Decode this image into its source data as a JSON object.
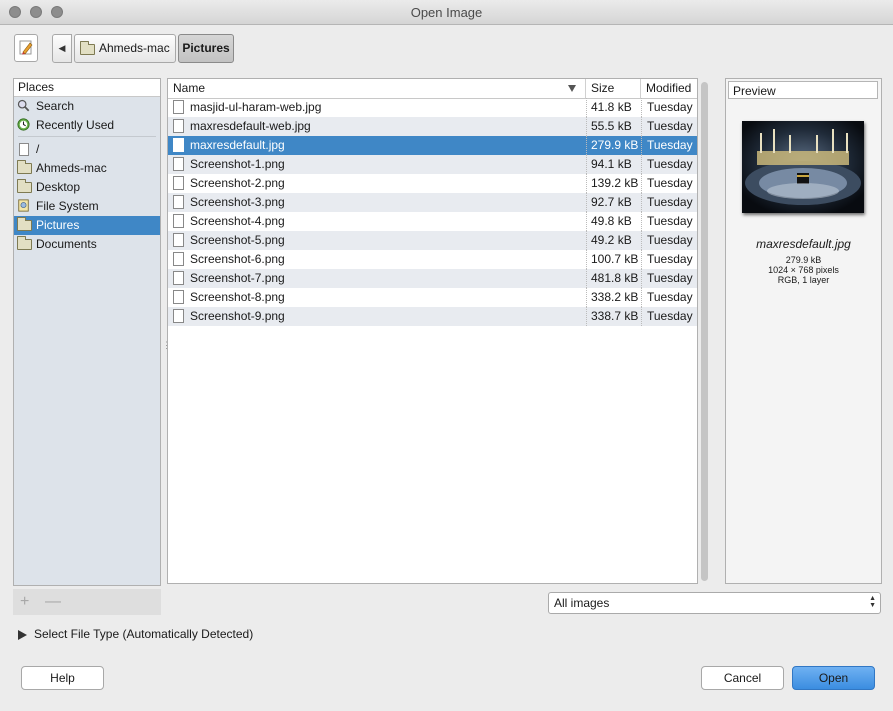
{
  "window": {
    "title": "Open Image"
  },
  "toolbar": {
    "breadcrumbs": [
      "Ahmeds-mac",
      "Pictures"
    ]
  },
  "places": {
    "header": "Places",
    "items": [
      {
        "label": "Search",
        "icon": "search-icon"
      },
      {
        "label": "Recently Used",
        "icon": "recent-icon"
      },
      {
        "label": "/",
        "icon": "document-icon"
      },
      {
        "label": "Ahmeds-mac",
        "icon": "folder-icon"
      },
      {
        "label": "Desktop",
        "icon": "folder-icon"
      },
      {
        "label": "File System",
        "icon": "drive-icon"
      },
      {
        "label": "Pictures",
        "icon": "folder-icon",
        "selected": true
      },
      {
        "label": "Documents",
        "icon": "folder-icon"
      }
    ]
  },
  "files": {
    "columns": {
      "name": "Name",
      "size": "Size",
      "modified": "Modified"
    },
    "rows": [
      {
        "name": "masjid-ul-haram-web.jpg",
        "size": "41.8 kB",
        "modified": "Tuesday"
      },
      {
        "name": "maxresdefault-web.jpg",
        "size": "55.5 kB",
        "modified": "Tuesday"
      },
      {
        "name": "maxresdefault.jpg",
        "size": "279.9 kB",
        "modified": "Tuesday",
        "selected": true
      },
      {
        "name": "Screenshot-1.png",
        "size": "94.1 kB",
        "modified": "Tuesday"
      },
      {
        "name": "Screenshot-2.png",
        "size": "139.2 kB",
        "modified": "Tuesday"
      },
      {
        "name": "Screenshot-3.png",
        "size": "92.7 kB",
        "modified": "Tuesday"
      },
      {
        "name": "Screenshot-4.png",
        "size": "49.8 kB",
        "modified": "Tuesday"
      },
      {
        "name": "Screenshot-5.png",
        "size": "49.2 kB",
        "modified": "Tuesday"
      },
      {
        "name": "Screenshot-6.png",
        "size": "100.7 kB",
        "modified": "Tuesday"
      },
      {
        "name": "Screenshot-7.png",
        "size": "481.8 kB",
        "modified": "Tuesday"
      },
      {
        "name": "Screenshot-8.png",
        "size": "338.2 kB",
        "modified": "Tuesday"
      },
      {
        "name": "Screenshot-9.png",
        "size": "338.7 kB",
        "modified": "Tuesday"
      }
    ]
  },
  "preview": {
    "header": "Preview",
    "filename": "maxresdefault.jpg",
    "size": "279.9 kB",
    "dimensions": "1024 × 768 pixels",
    "mode": "RGB, 1 layer"
  },
  "filter": {
    "selected": "All images"
  },
  "file_type": {
    "label": "Select File Type (Automatically Detected)"
  },
  "buttons": {
    "help": "Help",
    "cancel": "Cancel",
    "open": "Open"
  },
  "colors": {
    "selection": "#3f87c6",
    "open_button": "#3b8de0"
  }
}
